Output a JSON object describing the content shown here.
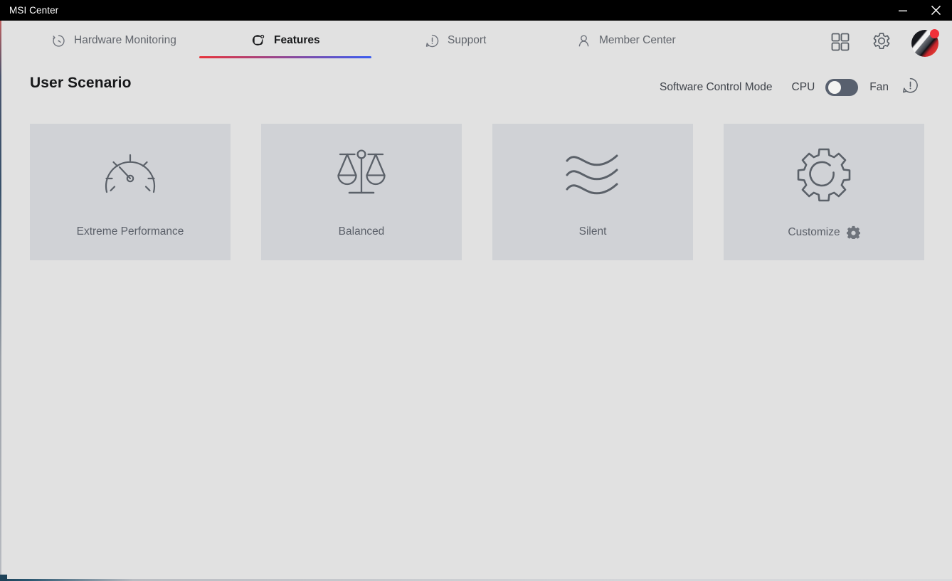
{
  "window": {
    "title": "MSI Center",
    "controls": [
      {
        "name": "minimize",
        "glyph": "minimize-icon"
      },
      {
        "name": "close",
        "glyph": "close-icon"
      }
    ]
  },
  "nav": {
    "tabs": [
      {
        "id": "hardware",
        "label": "Hardware Monitoring",
        "icon": "timer-icon",
        "active": false
      },
      {
        "id": "features",
        "label": "Features",
        "icon": "features-icon",
        "active": true
      },
      {
        "id": "support",
        "label": "Support",
        "icon": "support-bubble-icon",
        "active": false
      },
      {
        "id": "member",
        "label": "Member Center",
        "icon": "person-icon",
        "active": false
      }
    ],
    "actions": [
      {
        "id": "apps",
        "icon": "grid-icon"
      },
      {
        "id": "settings",
        "icon": "gear-icon"
      },
      {
        "id": "avatar",
        "icon": "avatar-icon",
        "badge": true
      }
    ],
    "active_underline_colors": {
      "from": "#e8333a",
      "to": "#3a5cf0"
    }
  },
  "main": {
    "page_title": "User Scenario",
    "control_mode": {
      "label": "Software Control Mode",
      "left_option": "CPU",
      "right_option": "Fan",
      "selected": "CPU",
      "toggle_state": "off",
      "info_icon": "info-bubble-icon",
      "toggle_track_color": "#58606e",
      "toggle_knob_color": "#f4f4f2"
    },
    "scenario_cards": [
      {
        "id": "extreme-performance",
        "label": "Extreme Performance",
        "icon": "gauge-icon",
        "has_settings_gear": false
      },
      {
        "id": "balanced",
        "label": "Balanced",
        "icon": "scale-icon",
        "has_settings_gear": false
      },
      {
        "id": "silent",
        "label": "Silent",
        "icon": "waves-icon",
        "has_settings_gear": false
      },
      {
        "id": "customize",
        "label": "Customize",
        "icon": "gear-outline-icon",
        "has_settings_gear": true
      }
    ],
    "card_background": "#d0d2d6",
    "page_background": "#e1e1e1"
  }
}
